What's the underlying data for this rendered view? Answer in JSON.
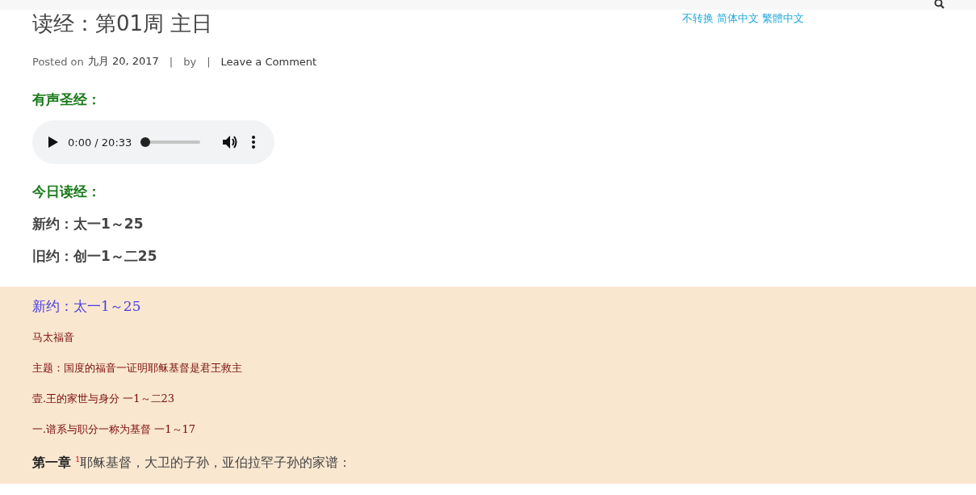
{
  "language_links": [
    "不转换",
    "简体中文",
    "繁體中文"
  ],
  "post": {
    "title": "读经：第01周 主日",
    "meta": {
      "posted_label": "Posted on",
      "date": "九月 20, 2017",
      "separator_1": "|",
      "by": "by",
      "separator_2": "|",
      "comment_link": "Leave a Comment"
    }
  },
  "audio_heading": "有声圣经：",
  "audio_player": {
    "time": "0:00 / 20:33",
    "level": 0
  },
  "reading_heading": "今日读经：",
  "readings": [
    "新约：太一1～25",
    "旧约：创一1～二25"
  ],
  "passage": {
    "heading": "新约：太一1～25",
    "lines": [
      "马太福音",
      "主题：国度的福音一证明耶稣基督是君王救主",
      "壹.王的家世与身分 一1～二23",
      "一.谱系与职分一称为基督 一1～17"
    ],
    "verse": "**第一章** $^{1}$耶稣基督，大卫的子孙，亚伯拉罕子孙的家谱："
  }
}
